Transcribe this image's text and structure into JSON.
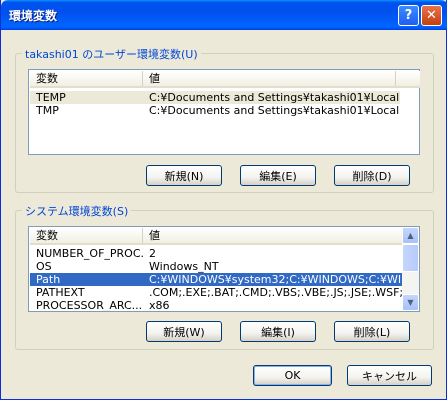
{
  "window": {
    "title": "環境変数",
    "help_label": "?",
    "close_label": "✕"
  },
  "user_vars": {
    "group_label": "takashi01 のユーザー環境変数(U)",
    "columns": [
      "変数",
      "値"
    ],
    "rows": [
      {
        "name": "TEMP",
        "value": "C:¥Documents and Settings¥takashi01¥Local ..."
      },
      {
        "name": "TMP",
        "value": "C:¥Documents and Settings¥takashi01¥Local ..."
      }
    ],
    "buttons": {
      "new": "新規(N)",
      "edit": "編集(E)",
      "delete": "削除(D)"
    }
  },
  "system_vars": {
    "group_label": "システム環境変数(S)",
    "columns": [
      "変数",
      "値"
    ],
    "rows": [
      {
        "name": "NUMBER_OF_PROC...",
        "value": "2"
      },
      {
        "name": "OS",
        "value": "Windows_NT"
      },
      {
        "name": "Path",
        "value": "C:¥WINDOWS¥system32;C:¥WINDOWS;C:¥WIN..."
      },
      {
        "name": "PATHEXT",
        "value": ".COM;.EXE;.BAT;.CMD;.VBS;.VBE;.JS;.JSE;.WSF;..."
      },
      {
        "name": "PROCESSOR_ARC...",
        "value": "x86"
      }
    ],
    "buttons": {
      "new": "新規(W)",
      "edit": "編集(I)",
      "delete": "削除(L)"
    },
    "scroll_up_icon": "arrow-up-icon",
    "scroll_down_icon": "arrow-down-icon"
  },
  "footer": {
    "ok": "OK",
    "cancel": "キャンセル"
  },
  "colors": {
    "title_bar": "#0053ee",
    "selection": "#316ac5",
    "group_label": "#0046d5",
    "dialog_bg": "#ece9d8"
  }
}
